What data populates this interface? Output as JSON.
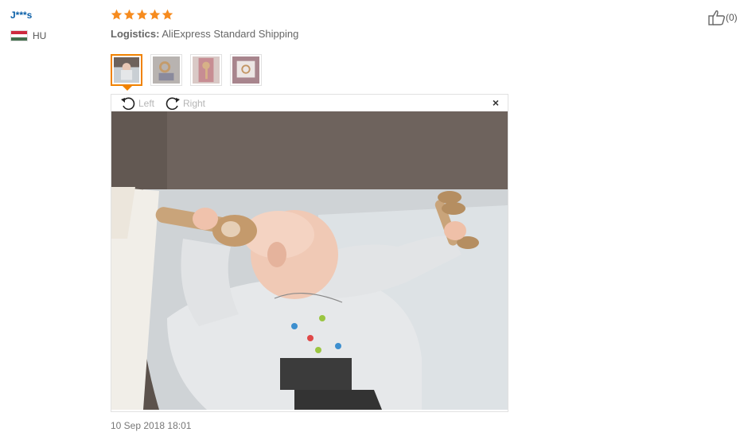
{
  "review": {
    "user_name": "J***s",
    "country_code": "HU",
    "rating": 5,
    "logistics_label": "Logistics:",
    "logistics_value": "AliExpress Standard Shipping",
    "helpful_count": "(0)",
    "date": "10 Sep 2018 18:01"
  },
  "viewer": {
    "rotate_left": "Left",
    "rotate_right": "Right",
    "close": "×"
  },
  "colors": {
    "star": "#f68b1e",
    "accent": "#f08200",
    "link": "#0a5fa8"
  },
  "icons": {
    "rating": "star-icon",
    "helpful": "thumbs-up-icon",
    "rotate_left": "rotate-left-icon",
    "rotate_right": "rotate-right-icon",
    "close": "close-icon"
  }
}
